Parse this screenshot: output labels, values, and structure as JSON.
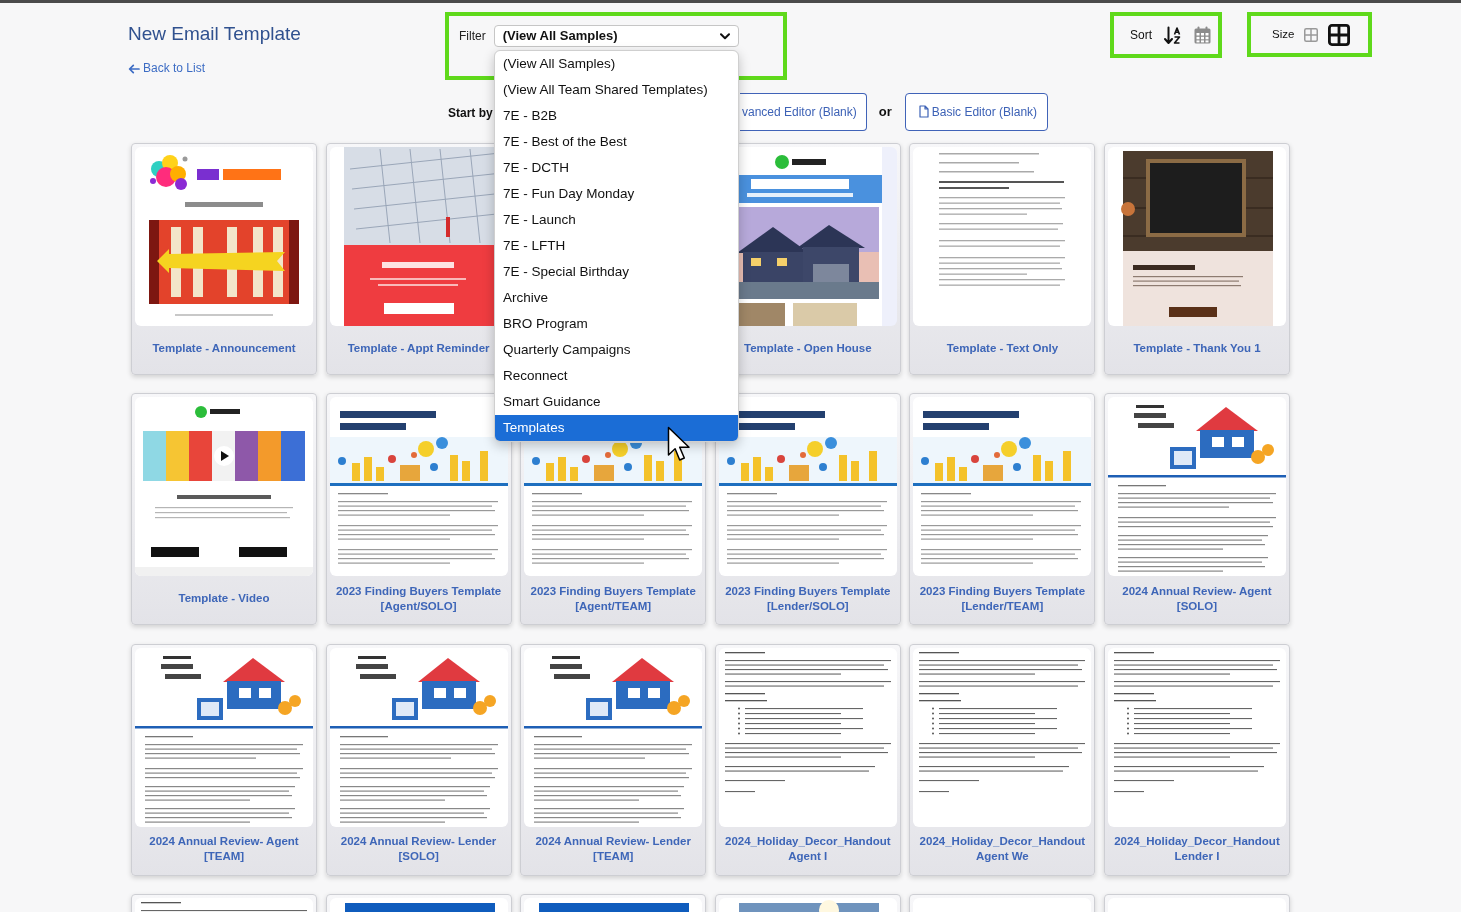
{
  "header": {
    "title": "New Email Template",
    "back_link": "Back to List"
  },
  "filter": {
    "label": "Filter",
    "value": "(View All Samples)",
    "highlighted": true,
    "expanded": true,
    "options": [
      {
        "label": "(View All Samples)",
        "highlighted": false
      },
      {
        "label": "(View All Team Shared Templates)",
        "highlighted": false
      },
      {
        "label": "7E - B2B",
        "highlighted": false
      },
      {
        "label": "7E - Best of the Best",
        "highlighted": false
      },
      {
        "label": "7E - DCTH",
        "highlighted": false
      },
      {
        "label": "7E - Fun Day Monday",
        "highlighted": false
      },
      {
        "label": "7E - Launch",
        "highlighted": false
      },
      {
        "label": "7E - LFTH",
        "highlighted": false
      },
      {
        "label": "7E - Special Birthday",
        "highlighted": false
      },
      {
        "label": "Archive",
        "highlighted": false
      },
      {
        "label": "BRO Program",
        "highlighted": false
      },
      {
        "label": "Quarterly Campaigns",
        "highlighted": false
      },
      {
        "label": "Reconnect",
        "highlighted": false
      },
      {
        "label": "Smart Guidance",
        "highlighted": false
      },
      {
        "label": "Templates",
        "highlighted": true
      }
    ]
  },
  "sort": {
    "label": "Sort",
    "highlighted": true,
    "options": [
      {
        "kind": "alphabetical",
        "selected": true
      },
      {
        "kind": "date",
        "selected": false
      }
    ]
  },
  "size": {
    "label": "Size",
    "highlighted": true,
    "options": [
      {
        "kind": "small",
        "selected": false
      },
      {
        "kind": "large",
        "selected": true
      }
    ]
  },
  "start": {
    "prompt": "Start by",
    "separator": "or",
    "buttons": [
      {
        "kind": "advanced",
        "label": "vanced Editor (Blank)"
      },
      {
        "kind": "basic",
        "label": "Basic Editor (Blank)"
      }
    ]
  },
  "templates": [
    {
      "kind": "card",
      "title": "Template - Announcement",
      "preview": {
        "kind": "announcement"
      }
    },
    {
      "kind": "card",
      "title": "Template - Appt Reminder",
      "preview": {
        "kind": "appointment"
      }
    },
    {
      "kind": "covered"
    },
    {
      "kind": "card",
      "title": "Template - Open House",
      "preview": {
        "kind": "open-house"
      }
    },
    {
      "kind": "card",
      "title": "Template - Text Only",
      "preview": {
        "kind": "text"
      }
    },
    {
      "kind": "card",
      "title": "Template - Thank You 1",
      "preview": {
        "kind": "thank-you"
      }
    },
    {
      "kind": "card",
      "title": "Template - Video",
      "preview": {
        "kind": "video"
      }
    },
    {
      "kind": "card",
      "title": "2023 Finding Buyers Template [Agent/SOLO]",
      "preview": {
        "kind": "buyers"
      }
    },
    {
      "kind": "card",
      "title": "2023 Finding Buyers Template [Agent/TEAM]",
      "preview": {
        "kind": "buyers"
      }
    },
    {
      "kind": "card",
      "title": "2023 Finding Buyers Template [Lender/SOLO]",
      "preview": {
        "kind": "buyers"
      }
    },
    {
      "kind": "card",
      "title": "2023 Finding Buyers Template [Lender/TEAM]",
      "preview": {
        "kind": "buyers"
      }
    },
    {
      "kind": "card",
      "title": "2024 Annual Review- Agent [SOLO]",
      "preview": {
        "kind": "review"
      }
    },
    {
      "kind": "card",
      "title": "2024 Annual Review- Agent [TEAM]",
      "preview": {
        "kind": "review"
      }
    },
    {
      "kind": "card",
      "title": "2024 Annual Review- Lender [SOLO]",
      "preview": {
        "kind": "review"
      }
    },
    {
      "kind": "card",
      "title": "2024 Annual Review- Lender [TEAM]",
      "preview": {
        "kind": "review"
      }
    },
    {
      "kind": "card",
      "title": "2024_Holiday_Decor_Handout Agent I",
      "preview": {
        "kind": "handout"
      }
    },
    {
      "kind": "card",
      "title": "2024_Holiday_Decor_Handout Agent We",
      "preview": {
        "kind": "handout"
      }
    },
    {
      "kind": "card",
      "title": "2024_Holiday_Decor_Handout Lender I",
      "preview": {
        "kind": "handout"
      }
    },
    {
      "kind": "card",
      "preview": {
        "kind": "handout"
      }
    },
    {
      "kind": "card",
      "preview": {
        "kind": "fun-day"
      }
    },
    {
      "kind": "card",
      "preview": {
        "kind": "fun-day"
      }
    },
    {
      "kind": "card",
      "preview": {
        "kind": "photo"
      }
    },
    {
      "kind": "card",
      "preview": {
        "kind": "blank"
      }
    },
    {
      "kind": "card",
      "preview": {
        "kind": "blank"
      }
    }
  ]
}
